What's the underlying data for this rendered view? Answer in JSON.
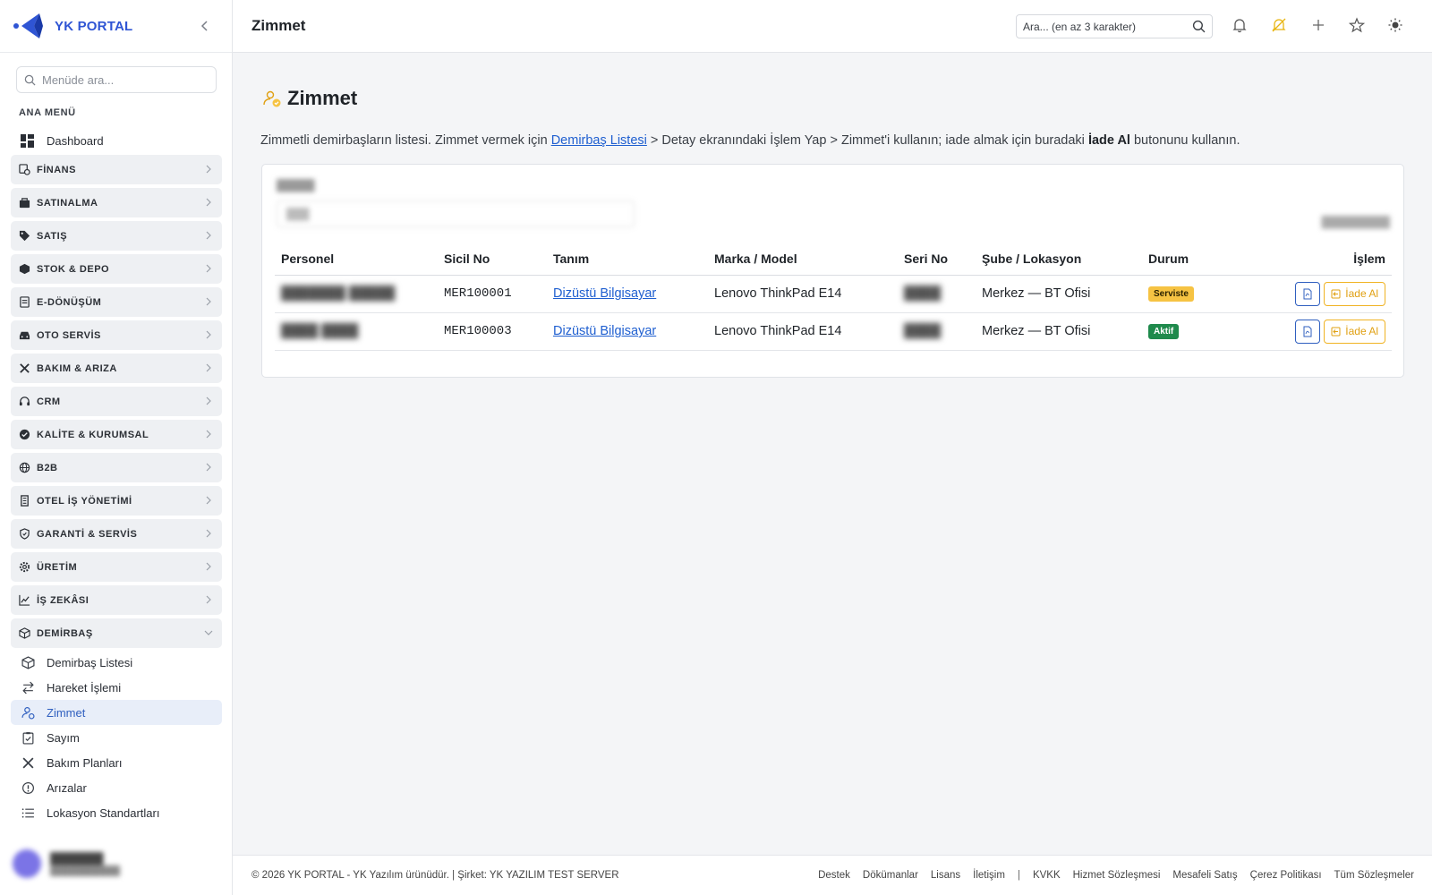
{
  "brand": {
    "name": "YK PORTAL",
    "accent": "#2f55d4"
  },
  "sidebar": {
    "search_placeholder": "Menüde ara...",
    "section_title": "ANA MENÜ",
    "dashboard_label": "Dashboard",
    "groups": [
      {
        "label": "FİNANS",
        "icon": "finance-icon"
      },
      {
        "label": "SATINALMA",
        "icon": "purchase-bag-icon"
      },
      {
        "label": "SATIŞ",
        "icon": "tag-icon"
      },
      {
        "label": "STOK & DEPO",
        "icon": "box-icon"
      },
      {
        "label": "E-DÖNÜŞÜM",
        "icon": "document-icon"
      },
      {
        "label": "OTO SERVİS",
        "icon": "car-icon"
      },
      {
        "label": "BAKIM & ARIZA",
        "icon": "tools-icon"
      },
      {
        "label": "CRM",
        "icon": "headset-icon"
      },
      {
        "label": "KALİTE & KURUMSAL",
        "icon": "verified-badge-icon"
      },
      {
        "label": "B2B",
        "icon": "globe-icon"
      },
      {
        "label": "OTEL İŞ YÖNETİMİ",
        "icon": "building-icon"
      },
      {
        "label": "GARANTİ & SERVİS",
        "icon": "shield-icon"
      },
      {
        "label": "ÜRETİM",
        "icon": "gear-icon"
      },
      {
        "label": "İŞ ZEKÂSI",
        "icon": "chart-line-icon"
      },
      {
        "label": "DEMİRBAŞ",
        "icon": "cube-icon"
      }
    ],
    "demirbas_items": [
      {
        "label": "Demirbaş Listesi",
        "icon": "cube-icon"
      },
      {
        "label": "Hareket İşlemi",
        "icon": "transfer-icon"
      },
      {
        "label": "Zimmet",
        "icon": "user-assign-icon",
        "active": true
      },
      {
        "label": "Sayım",
        "icon": "clipboard-check-icon"
      },
      {
        "label": "Bakım Planları",
        "icon": "tools-icon"
      },
      {
        "label": "Arızalar",
        "icon": "alert-circle-icon"
      },
      {
        "label": "Lokasyon Standartları",
        "icon": "list-icon"
      }
    ]
  },
  "topbar": {
    "title": "Zimmet",
    "search_placeholder": "Ara... (en az 3 karakter)"
  },
  "page": {
    "title": "Zimmet",
    "intro": {
      "part1": "Zimmetli demirbaşların listesi. Zimmet vermek için ",
      "link": "Demirbaş Listesi",
      "part2": " > Detay ekranındaki İşlem Yap > Zimmet'i kullanın; iade almak için buradaki ",
      "bold": "İade Al",
      "part3": " butonunu kullanın."
    },
    "table": {
      "headers": [
        "Personel",
        "Sicil No",
        "Tanım",
        "Marka / Model",
        "Seri No",
        "Şube / Lokasyon",
        "Durum",
        "İşlem"
      ],
      "return_label": "İade Al",
      "rows": [
        {
          "sicil": "MER100001",
          "tanim": "Dizüstü Bilgisayar",
          "model": "Lenovo ThinkPad E14",
          "lokasyon": "Merkez — BT Ofisi",
          "durum": "Serviste",
          "durum_color": "#f6c343"
        },
        {
          "sicil": "MER100003",
          "tanim": "Dizüstü Bilgisayar",
          "model": "Lenovo ThinkPad E14",
          "lokasyon": "Merkez — BT Ofisi",
          "durum": "Aktif",
          "durum_color": "#1f8a4c"
        }
      ]
    }
  },
  "footer": {
    "copyright": "© 2026 YK PORTAL - YK Yazılım ürünüdür. | Şirket: YK YAZILIM TEST SERVER",
    "links_left": [
      "Destek",
      "Dökümanlar",
      "Lisans",
      "İletişim"
    ],
    "links_right": [
      "KVKK",
      "Hizmet Sözleşmesi",
      "Mesafeli Satış",
      "Çerez Politikası",
      "Tüm Sözleşmeler"
    ]
  }
}
